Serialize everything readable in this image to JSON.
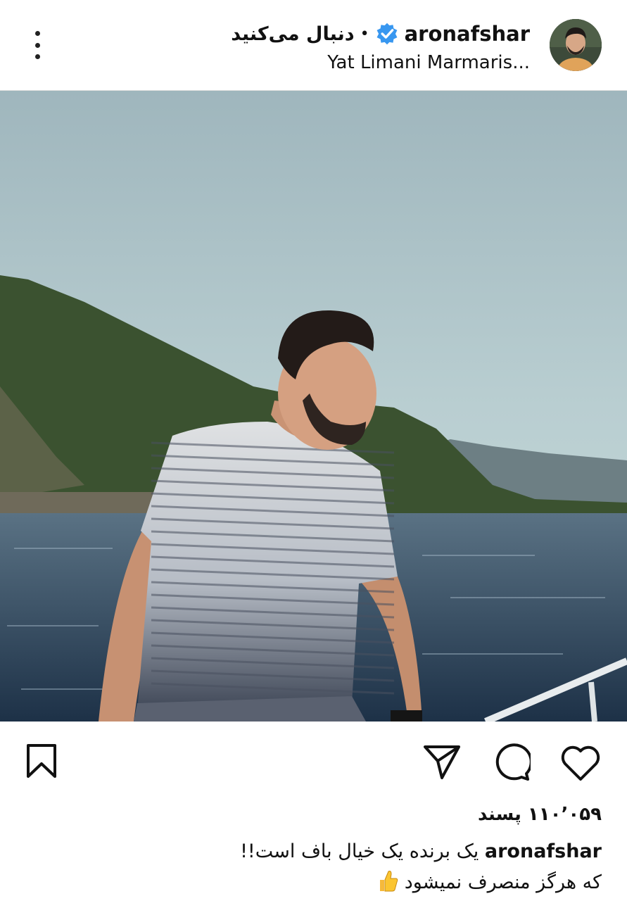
{
  "header": {
    "username": "aronafshar",
    "follow_label": "دنبال می‌کنید",
    "separator": "•",
    "location": "Yat Limani Marmaris...",
    "verified_icon": "verified-badge-icon",
    "menu_icon": "more-vertical-icon",
    "verified_color": "#3897f0"
  },
  "post": {
    "likes_count": "۱۱۰٬۰۵۹",
    "likes_word": "پسند",
    "caption_user": "aronafshar",
    "caption_line1": "یک برنده یک خیال باف است!!",
    "caption_line2": "که هرگز منصرف نمیشود",
    "caption_emoji": "thumbs-up-icon"
  },
  "actions": {
    "like_icon": "heart-icon",
    "comment_icon": "comment-icon",
    "share_icon": "send-icon",
    "save_icon": "bookmark-icon"
  }
}
